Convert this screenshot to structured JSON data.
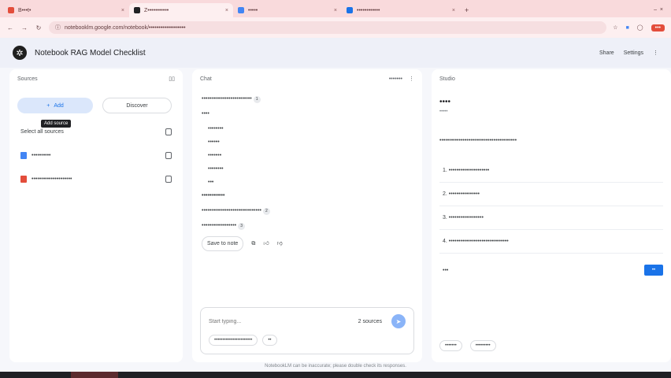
{
  "browser": {
    "tabs": [
      {
        "label": "B•••t•",
        "fav": "#e34d3b",
        "active": false
      },
      {
        "label": "Z•••••••••••",
        "fav": "#202124",
        "active": true
      },
      {
        "label": "•••••",
        "fav": "#4285f4",
        "active": false
      },
      {
        "label": "••••••••••••",
        "fav": "#1a73e8",
        "active": false
      }
    ],
    "url": "notebooklm.google.com/notebook/•••••••••••••••••••",
    "right_label": "•••"
  },
  "app": {
    "title": "Notebook RAG Model Checklist",
    "share_label": "Share",
    "settings_label": "Settings"
  },
  "sources": {
    "title": "Sources",
    "add_label": "Add",
    "discover_label": "Discover",
    "tooltip": "Add source",
    "select_all": "Select all sources",
    "items": [
      {
        "label": "••••••••••",
        "type": "doc"
      },
      {
        "label": "•••••••••••••••••••••",
        "type": "pdf"
      }
    ]
  },
  "chat": {
    "title": "Chat",
    "header_right": "•••••••",
    "intro": "••••••••••••••••••••••••••",
    "subhead": "••••",
    "list": [
      "••••••••",
      "••••••",
      "•••••••",
      "••••••••",
      "•••"
    ],
    "section": "••••••••••••",
    "para1": "•••••••••••••••••••••••••••••••",
    "para2": "••••••••••••••••••",
    "save_label": "Save to note",
    "input_placeholder": "Start typing...",
    "source_count": "2 sources",
    "suggestion": "•••••••••••••••••••••••",
    "more_label": "••",
    "footer": "NotebookLM can be inaccurate; please double check its responses."
  },
  "studio": {
    "title": "Studio",
    "note_title": "••••",
    "note_sub": "•••••",
    "lead": "••••••••••••••••••••••••••••••••••••••••",
    "items": [
      "1. •••••••••••••••••••••",
      "2. ••••••••••••••••",
      "3. ••••••••••••••••••",
      "4. •••••••••••••••••••••••••••••••"
    ],
    "ask_label": "•••",
    "ask_btn": "••",
    "btn1": "•••••••",
    "btn2": "•••••••••"
  }
}
